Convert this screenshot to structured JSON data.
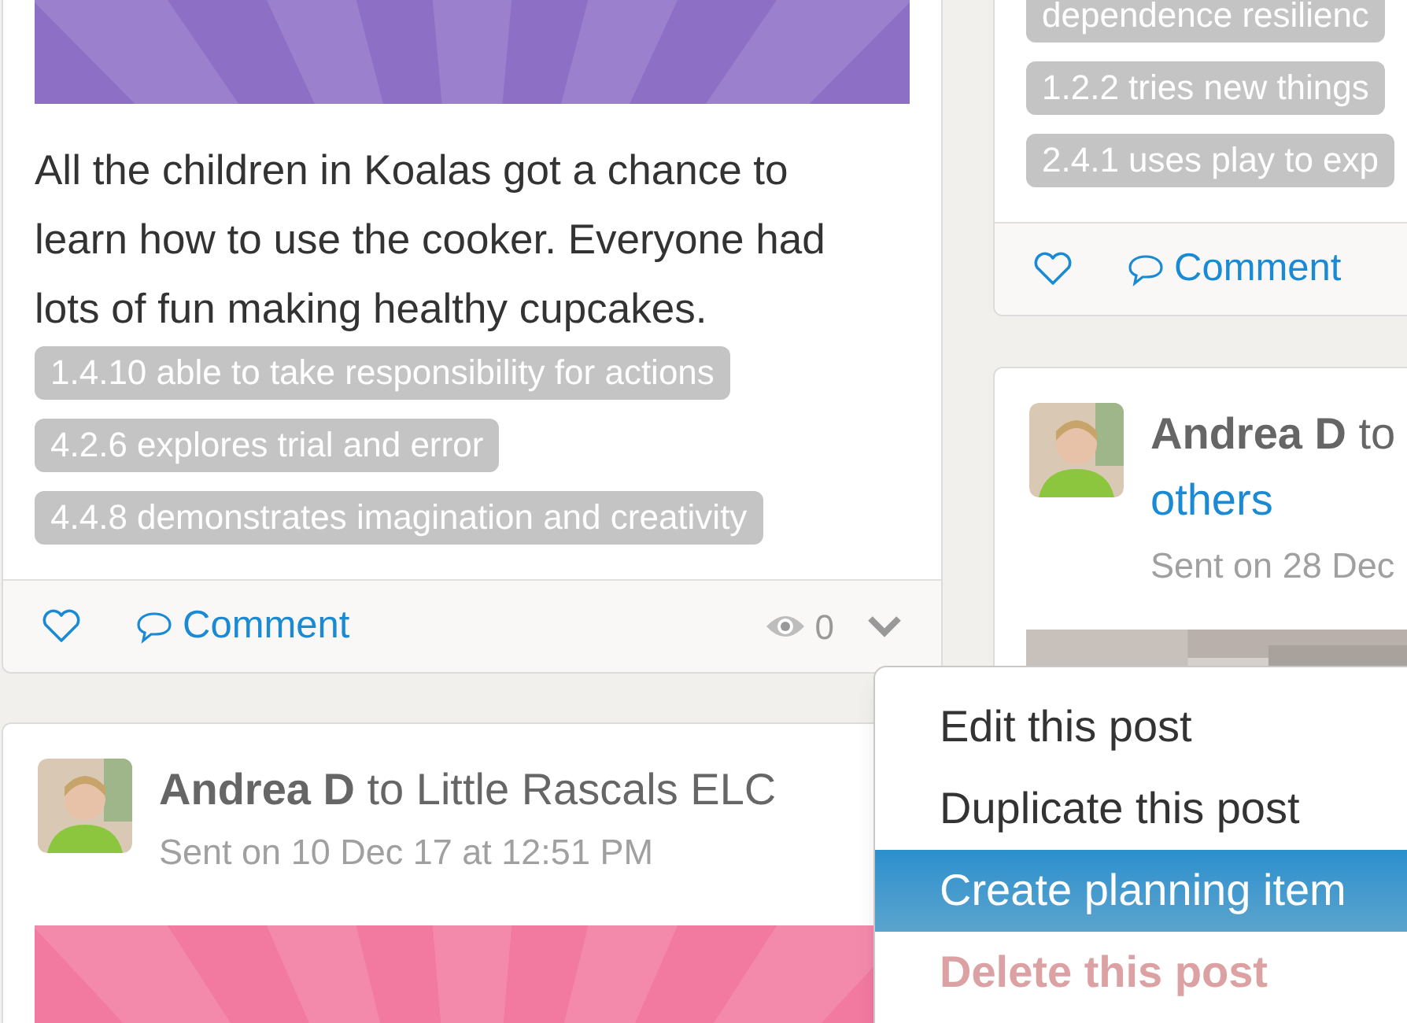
{
  "left_column": {
    "posts": [
      {
        "kind": "full",
        "picture": {
          "color": "#8e6fc6"
        },
        "body": "All the children in Koalas got a chance to learn how to use the cooker. Everyone had lots of fun making healthy cupcakes.",
        "tags": [
          "1.4.10 able to take responsibility for actions",
          "4.2.6 explores trial and error",
          "4.4.8 demonstrates imagination and creativity"
        ],
        "liked": false,
        "comment_label": "Comment",
        "views": "0"
      },
      {
        "kind": "header",
        "author": "Andrea D",
        "audience_prefix": "to",
        "audience": "Little Rascals ELC",
        "audience_link": false,
        "sent": "Sent on 10 Dec 17 at 12:51 PM",
        "picture": {
          "color": "#f27aa0"
        }
      }
    ]
  },
  "right_column": {
    "posts": [
      {
        "kind": "tail",
        "tags": [
          "dependence resilienc",
          "1.2.2 tries new things",
          "2.4.1 uses play to exp"
        ],
        "liked": false,
        "comment_label": "Comment"
      },
      {
        "kind": "header",
        "author": "Andrea D",
        "audience_prefix": "to",
        "audience": "others",
        "audience_link": true,
        "sent": "Sent on 28 Dec",
        "picture": {
          "color": "#b9b0ab"
        }
      }
    ]
  },
  "post_menu": {
    "items": [
      {
        "label": "Edit this post",
        "kind": "normal",
        "selected": false
      },
      {
        "label": "Duplicate this post",
        "kind": "normal",
        "selected": false
      },
      {
        "label": "Create planning item",
        "kind": "normal",
        "selected": true
      },
      {
        "label": "Delete this post",
        "kind": "danger",
        "selected": false
      }
    ]
  }
}
